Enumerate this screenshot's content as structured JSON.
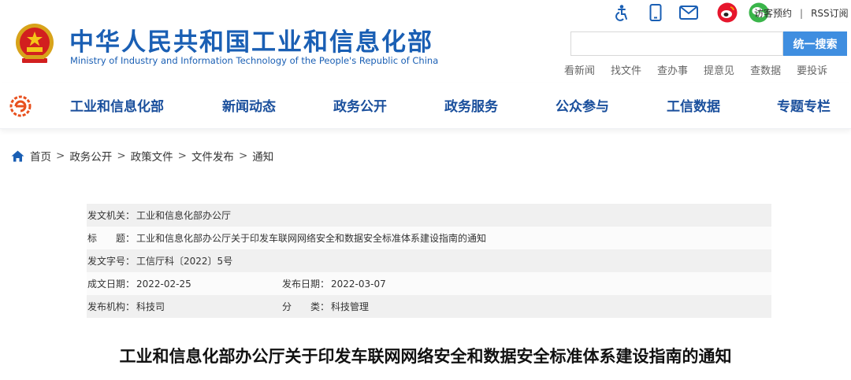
{
  "header": {
    "site_title": "中华人民共和国工业和信息化部",
    "site_subtitle": "Ministry of Industry and Information Technology of the People's Republic of China",
    "top_icons": [
      "accessibility-icon",
      "mobile-icon",
      "mail-icon",
      "weibo-icon",
      "wechat-icon"
    ],
    "top_links": [
      "访客预约",
      "RSS订阅"
    ],
    "top_links_separator": "|",
    "search": {
      "placeholder": "",
      "button_label": "统一搜索"
    },
    "quick_links": [
      "看新闻",
      "找文件",
      "查办事",
      "提意见",
      "查数据",
      "要投诉"
    ]
  },
  "nav": {
    "items": [
      "工业和信息化部",
      "新闻动态",
      "政务公开",
      "政务服务",
      "公众参与",
      "工信数据",
      "专题专栏"
    ]
  },
  "breadcrumb": {
    "items": [
      "首页",
      "政务公开",
      "政策文件",
      "文件发布",
      "通知"
    ],
    "separator": ">"
  },
  "info": {
    "issuer_label": "发文机关：",
    "issuer": "工业和信息化部办公厅",
    "title_label": "标　　题：",
    "title": "工业和信息化部办公厅关于印发车联网网络安全和数据安全标准体系建设指南的通知",
    "doc_number_label": "发文字号：",
    "doc_number": "工信厅科〔2022〕5号",
    "written_date_label": "成文日期：",
    "written_date": "2022-02-25",
    "publish_date_label": "发布日期：",
    "publish_date": "2022-03-07",
    "agency_label": "发布机构：",
    "agency": "科技司",
    "category_label": "分　　类：",
    "category": "科技管理"
  },
  "document": {
    "title": "工业和信息化部办公厅关于印发车联网网络安全和数据安全标准体系建设指南的通知"
  },
  "colors": {
    "brand_blue": "#1a5fb4",
    "nav_text": "#1a4f9c",
    "search_button": "#3f8ee0",
    "weibo": "#e6162d",
    "wechat": "#3ab54a"
  }
}
